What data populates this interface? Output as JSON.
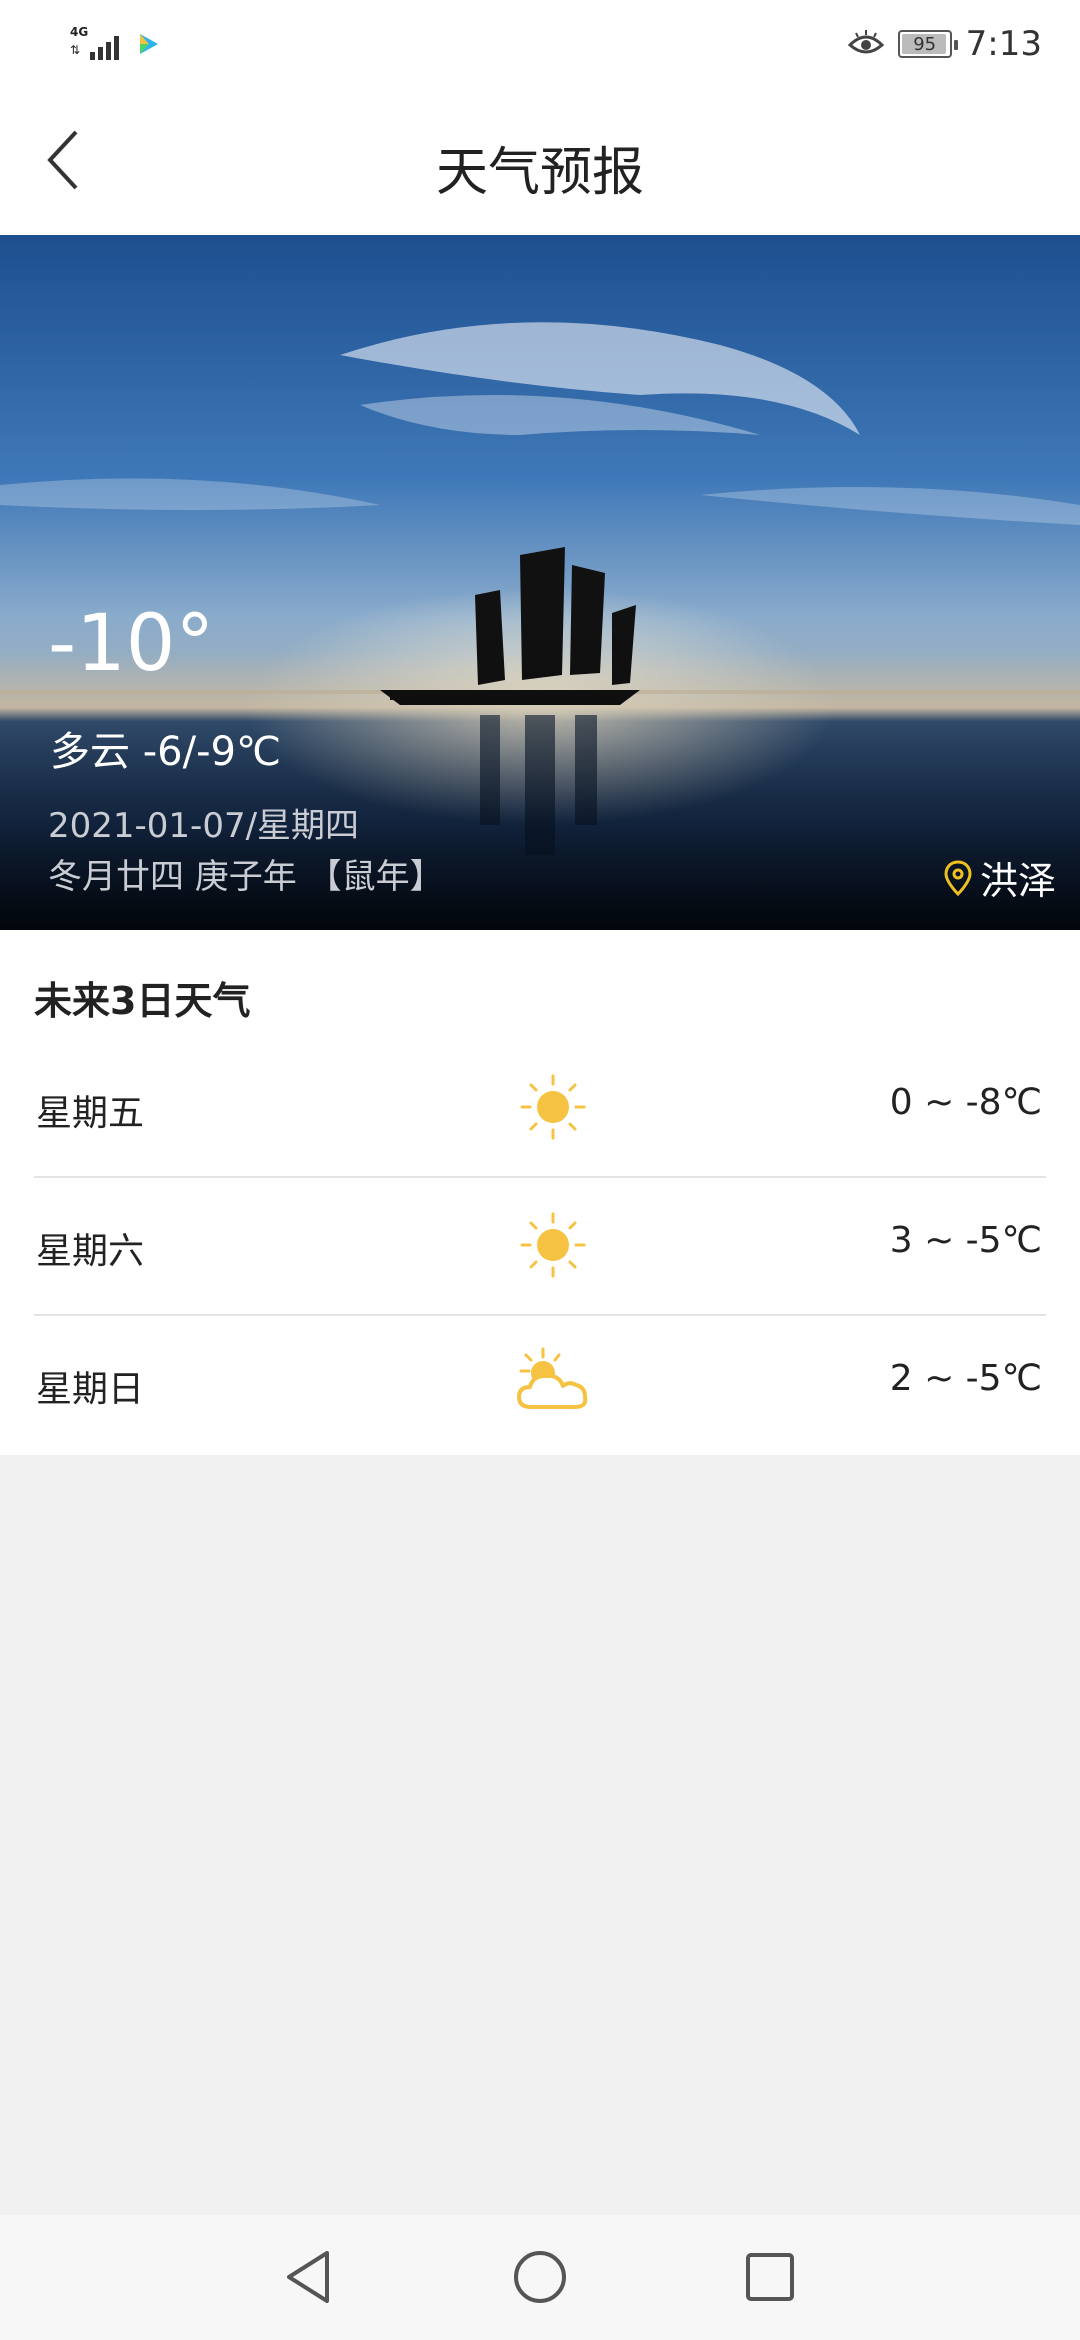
{
  "status_bar": {
    "network": "4G",
    "battery": "95",
    "time": "7:13",
    "icons": [
      "signal-icon",
      "play-app-icon",
      "eye-comfort-icon",
      "battery-icon"
    ]
  },
  "header": {
    "title": "天气预报",
    "back_icon": "chevron-left-icon"
  },
  "current": {
    "temperature": "-10°",
    "condition": "多云 -6/-9℃",
    "date": "2021-01-07/星期四",
    "lunar": "冬月廿四 庚子年 【鼠年】",
    "location": "洪泽",
    "location_icon": "map-pin-icon",
    "background": "sailboat at sunset over water"
  },
  "forecast": {
    "title": "未来3日天气",
    "days": [
      {
        "day": "星期五",
        "icon": "sunny-icon",
        "range": "0 ~ -8℃"
      },
      {
        "day": "星期六",
        "icon": "sunny-icon",
        "range": "3 ~ -5℃"
      },
      {
        "day": "星期日",
        "icon": "partly-cloudy-icon",
        "range": "2 ~ -5℃"
      }
    ]
  },
  "nav": {
    "icons": [
      "back-triangle-icon",
      "home-circle-icon",
      "recents-square-icon"
    ]
  },
  "colors": {
    "sun": "#f5c242",
    "location_pin": "#f0c020",
    "sky_top": "#1f4e8c",
    "sea": "#0e2240"
  }
}
